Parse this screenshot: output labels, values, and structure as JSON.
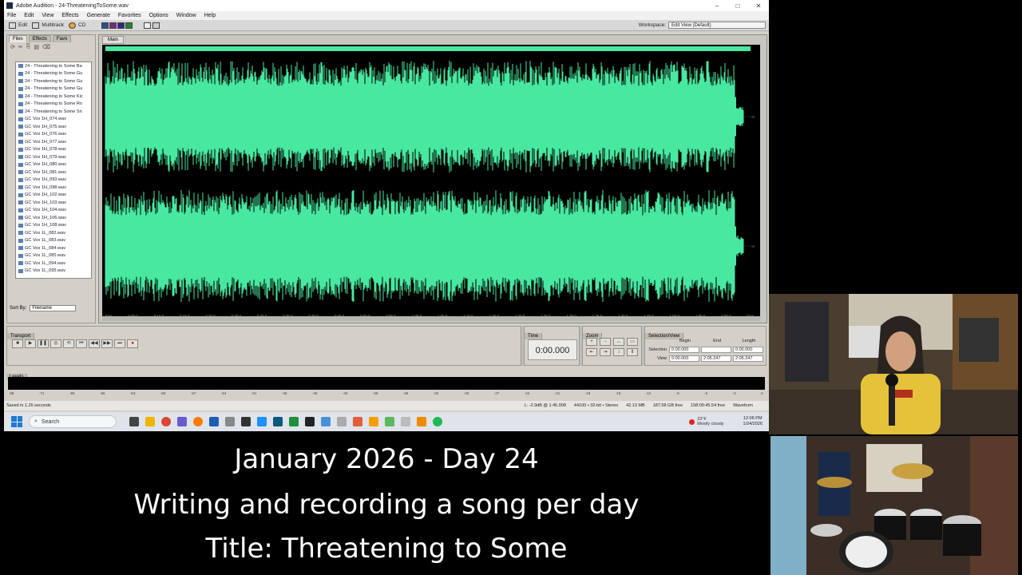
{
  "window": {
    "title": "Adobe Audition - 24-ThreateningToSome.wav",
    "min": "–",
    "max": "□",
    "close": "✕"
  },
  "menu": [
    "File",
    "Edit",
    "View",
    "Effects",
    "Generate",
    "Favorites",
    "Options",
    "Window",
    "Help"
  ],
  "toolbar": {
    "edit_label": "Edit",
    "multitrack_label": "Multitrack",
    "cd_label": "CD",
    "workspace_label": "Workspace:",
    "workspace_value": "Edit View (Default)"
  },
  "files_panel": {
    "tabs": [
      "Files",
      "Effects",
      "Favo"
    ],
    "files": [
      "24 - Threatening to Some Ba",
      "24 - Threatening to Some Gu",
      "24 - Threatening to Some Gu",
      "24 - Threatening to Some Gu",
      "24 - Threatening to Some Kic",
      "24 - Threatening to Some Ro",
      "24 - Threatening to Some Sn",
      "GC Vox 1H_074.wav",
      "GC Vox 1H_075.wav",
      "GC Vox 1H_076.wav",
      "GC Vox 1H_077.wav",
      "GC Vox 1H_078.wav",
      "GC Vox 1H_079.wav",
      "GC Vox 1H_080.wav",
      "GC Vox 1H_081.wav",
      "GC Vox 1H_093.wav",
      "GC Vox 1H_098.wav",
      "GC Vox 1H_102.wav",
      "GC Vox 1H_103.wav",
      "GC Vox 1H_104.wav",
      "GC Vox 1H_106.wav",
      "GC Vox 1H_108.wav",
      "GC Vox 1L_082.wav",
      "GC Vox 1L_083.wav",
      "GC Vox 1L_084.wav",
      "GC Vox 1L_085.wav",
      "GC Vox 1L_094.wav",
      "GC Vox 1L_095.wav"
    ],
    "sort_label": "Sort By:",
    "sort_value": "Filename"
  },
  "editor": {
    "tab": "Main",
    "time_ticks": [
      "hms",
      "0:05.0",
      "0:10.0",
      "0:15.0",
      "0:20.0",
      "0:25.0",
      "0:30.0",
      "0:35.0",
      "0:40.0",
      "0:45.0",
      "0:50.0",
      "0:55.0",
      "1:00.0",
      "1:05.0",
      "1:10.0",
      "1:15.0",
      "1:20.0",
      "1:25.0",
      "1:30.0",
      "1:35.0",
      "1:40.0",
      "1:45.0",
      "1:50.0",
      "1:55.0",
      "2:00.0",
      "hms"
    ],
    "colors": {
      "waveform": "#48e8a0",
      "background": "#000000"
    }
  },
  "transport": {
    "title": "Transport",
    "buttons": [
      "■",
      "▶",
      "❚❚",
      "◎",
      "⟲",
      "⏮",
      "◀◀",
      "▶▶",
      "⏭",
      "●"
    ]
  },
  "time_panel": {
    "title": "Time",
    "value": "0:00.000"
  },
  "zoom_panel": {
    "title": "Zoom"
  },
  "selection_panel": {
    "title": "Selection/View",
    "headers": [
      "Begin",
      "End",
      "Length"
    ],
    "selection_label": "Selection",
    "view_label": "View",
    "selection": [
      "0:00.000",
      "",
      "0:00.000"
    ],
    "view": [
      "0:00.000",
      "2:05.247",
      "2:05.247"
    ]
  },
  "levels": {
    "title": "Levels",
    "scale": [
      "dB",
      "-71",
      "-69",
      "-66",
      "-63",
      "-60",
      "-57",
      "-54",
      "-51",
      "-48",
      "-45",
      "-42",
      "-39",
      "-36",
      "-33",
      "-30",
      "-27",
      "-24",
      "-21",
      "-18",
      "-15",
      "-12",
      "-9",
      "-6",
      "-3",
      "0"
    ]
  },
  "status": {
    "left": "Saved in 1.26 seconds",
    "level": "L: -2.9dB @ 1:45.908",
    "format": "44100 • 32-bit • Stereo",
    "size": "42.13 MB",
    "free": "187.58 GB free",
    "time_free": "158:09:45.54 free",
    "mode": "Waveform"
  },
  "taskbar": {
    "search": "Search",
    "temp": "23°F",
    "weather": "Mostly cloudy",
    "time": "12:06 PM",
    "date": "1/24/2026"
  },
  "caption": {
    "line1": "January 2026 - Day 24",
    "line2": "Writing and recording a song per day",
    "line3": "Title: Threatening to Some"
  }
}
